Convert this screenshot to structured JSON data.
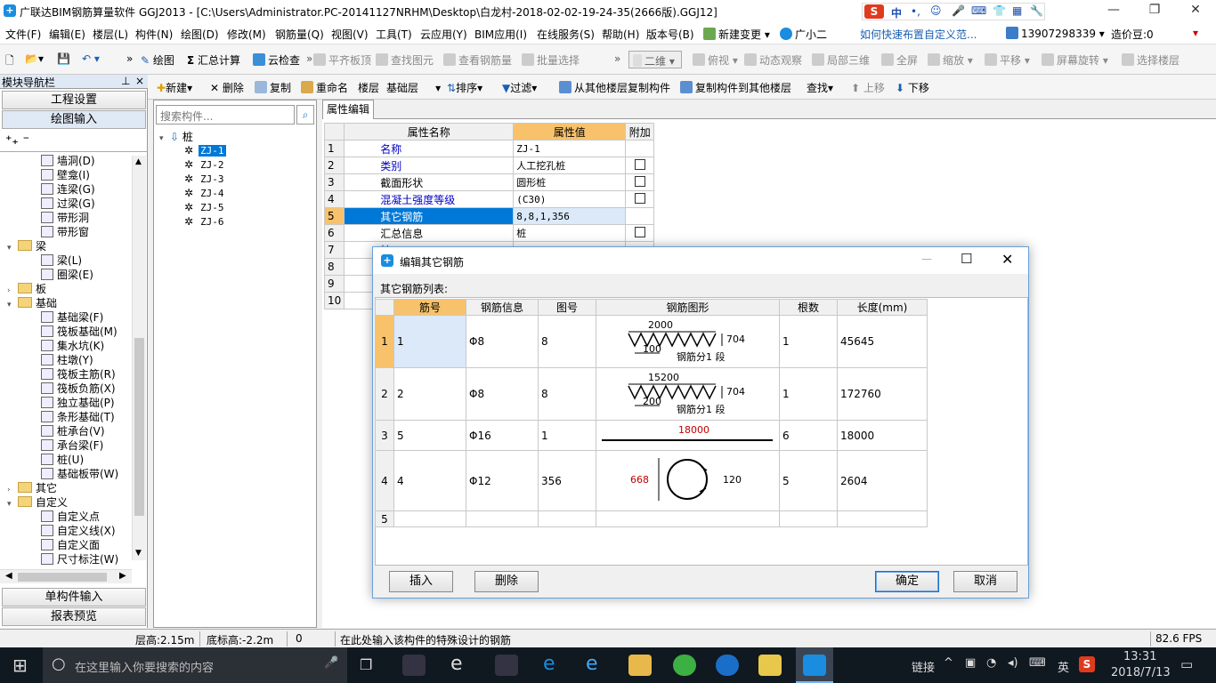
{
  "window": {
    "title": "广联达BIM钢筋算量软件 GGJ2013 - [C:\\Users\\Administrator.PC-20141127NRHM\\Desktop\\白龙村-2018-02-02-19-24-35(2666版).GGJ12]"
  },
  "menu": [
    "文件(F)",
    "编辑(E)",
    "楼层(L)",
    "构件(N)",
    "绘图(D)",
    "修改(M)",
    "钢筋量(Q)",
    "视图(V)",
    "工具(T)",
    "云应用(Y)",
    "BIM应用(I)",
    "在线服务(S)",
    "帮助(H)",
    "版本号(B)",
    "新建变更",
    "广小二"
  ],
  "menu_right": {
    "tip": "如何快速布置自定义范...",
    "phone": "13907298339",
    "beans": "造价豆:0"
  },
  "toolbar1": [
    "绘图",
    "汇总计算",
    "云检查",
    "平齐板顶",
    "查找图元",
    "查看钢筋量",
    "批量选择",
    "二维",
    "俯视",
    "动态观察",
    "局部三维",
    "全屏",
    "缩放",
    "平移",
    "屏幕旋转",
    "选择楼层"
  ],
  "toolbar2": {
    "new": "新建",
    "delete": "删除",
    "copy": "复制",
    "rename": "重命名",
    "floor_label": "楼层",
    "floor_value": "基础层",
    "sort": "排序",
    "filter": "过滤",
    "copy_from": "从其他楼层复制构件",
    "copy_to": "复制构件到其他楼层",
    "find": "查找",
    "up": "上移",
    "down": "下移"
  },
  "nav": {
    "title": "模块导航栏",
    "project": "工程设置",
    "draw": "绘图输入",
    "single": "单构件输入",
    "report": "报表预览",
    "tree": [
      {
        "label": "墙洞(D)",
        "level": 2
      },
      {
        "label": "壁龛(I)",
        "level": 2
      },
      {
        "label": "连梁(G)",
        "level": 2
      },
      {
        "label": "过梁(G)",
        "level": 2
      },
      {
        "label": "带形洞",
        "level": 2
      },
      {
        "label": "带形窗",
        "level": 2
      },
      {
        "label": "梁",
        "level": 1,
        "folder": true,
        "open": true
      },
      {
        "label": "梁(L)",
        "level": 2
      },
      {
        "label": "圈梁(E)",
        "level": 2
      },
      {
        "label": "板",
        "level": 1,
        "folder": true,
        "open": false
      },
      {
        "label": "基础",
        "level": 1,
        "folder": true,
        "open": true
      },
      {
        "label": "基础梁(F)",
        "level": 2
      },
      {
        "label": "筏板基础(M)",
        "level": 2
      },
      {
        "label": "集水坑(K)",
        "level": 2
      },
      {
        "label": "柱墩(Y)",
        "level": 2
      },
      {
        "label": "筏板主筋(R)",
        "level": 2
      },
      {
        "label": "筏板负筋(X)",
        "level": 2
      },
      {
        "label": "独立基础(P)",
        "level": 2
      },
      {
        "label": "条形基础(T)",
        "level": 2
      },
      {
        "label": "桩承台(V)",
        "level": 2
      },
      {
        "label": "承台梁(F)",
        "level": 2
      },
      {
        "label": "桩(U)",
        "level": 2
      },
      {
        "label": "基础板带(W)",
        "level": 2
      },
      {
        "label": "其它",
        "level": 1,
        "folder": true,
        "open": false
      },
      {
        "label": "自定义",
        "level": 1,
        "folder": true,
        "open": true
      },
      {
        "label": "自定义点",
        "level": 2
      },
      {
        "label": "自定义线(X)",
        "level": 2
      },
      {
        "label": "自定义面",
        "level": 2
      },
      {
        "label": "尺寸标注(W)",
        "level": 2
      }
    ]
  },
  "components": {
    "search_placeholder": "搜索构件...",
    "root": "桩",
    "items": [
      "ZJ-1",
      "ZJ-2",
      "ZJ-3",
      "ZJ-4",
      "ZJ-5",
      "ZJ-6"
    ],
    "selected": "ZJ-1"
  },
  "props": {
    "tab": "属性编辑",
    "headers": [
      "属性名称",
      "属性值",
      "附加"
    ],
    "rows": [
      {
        "n": "1",
        "name": "名称",
        "value": "ZJ-1",
        "blue": true,
        "check": false
      },
      {
        "n": "2",
        "name": "类别",
        "value": "人工挖孔桩",
        "blue": true,
        "check": true
      },
      {
        "n": "3",
        "name": "截面形状",
        "value": "圆形桩",
        "blue": false,
        "check": true
      },
      {
        "n": "4",
        "name": "混凝土强度等级",
        "value": "(C30)",
        "blue": true,
        "check": true
      },
      {
        "n": "5",
        "name": "其它钢筋",
        "value": "8,8,1,356",
        "blue": false,
        "check": false
      },
      {
        "n": "6",
        "name": "汇总信息",
        "value": "桩",
        "blue": false,
        "check": true
      },
      {
        "n": "7",
        "name": "桩",
        "value": "",
        "blue": false,
        "check": false
      },
      {
        "n": "8",
        "name": "顶",
        "value": "",
        "blue": false,
        "check": false
      },
      {
        "n": "9",
        "name": "备",
        "value": "",
        "blue": false,
        "check": false
      },
      {
        "n": "10",
        "name": "显",
        "value": "",
        "blue": false,
        "check": false
      }
    ]
  },
  "dialog": {
    "title": "编辑其它钢筋",
    "list_label": "其它钢筋列表:",
    "headers": [
      "筋号",
      "钢筋信息",
      "图号",
      "钢筋图形",
      "根数",
      "长度(mm)"
    ],
    "rows": [
      {
        "n": "1",
        "bar": "1",
        "info": "Φ8",
        "fig": "8",
        "count": "1",
        "length": "45645",
        "shape": {
          "top": "2000",
          "side": "704",
          "pitch": "100",
          "caption": "钢筋分1 段"
        }
      },
      {
        "n": "2",
        "bar": "2",
        "info": "Φ8",
        "fig": "8",
        "count": "1",
        "length": "172760",
        "shape": {
          "top": "15200",
          "side": "704",
          "pitch": "200",
          "caption": "钢筋分1 段"
        }
      },
      {
        "n": "3",
        "bar": "5",
        "info": "Φ16",
        "fig": "1",
        "count": "6",
        "length": "18000",
        "shape": {
          "len": "18000"
        }
      },
      {
        "n": "4",
        "bar": "4",
        "info": "Φ12",
        "fig": "356",
        "count": "5",
        "length": "2604",
        "shape": {
          "dia": "668",
          "hook": "120"
        }
      },
      {
        "n": "5",
        "bar": "",
        "info": "",
        "fig": "",
        "count": "",
        "length": "",
        "shape": null
      }
    ],
    "insert": "插入",
    "delete": "删除",
    "ok": "确定",
    "cancel": "取消"
  },
  "status": {
    "floor_height": "层高:2.15m",
    "base_height": "底标高:-2.2m",
    "zero": "0",
    "hint": "在此处输入该构件的特殊设计的钢筋",
    "fps": "82.6 FPS"
  },
  "taskbar": {
    "search_placeholder": "在这里输入你要搜索的内容",
    "link": "链接",
    "ime": "英",
    "time": "13:31",
    "date": "2018/7/13"
  },
  "colors": {
    "accent": "#1a8de0",
    "selected": "#0078d7",
    "header_orange": "#f7c26b"
  }
}
